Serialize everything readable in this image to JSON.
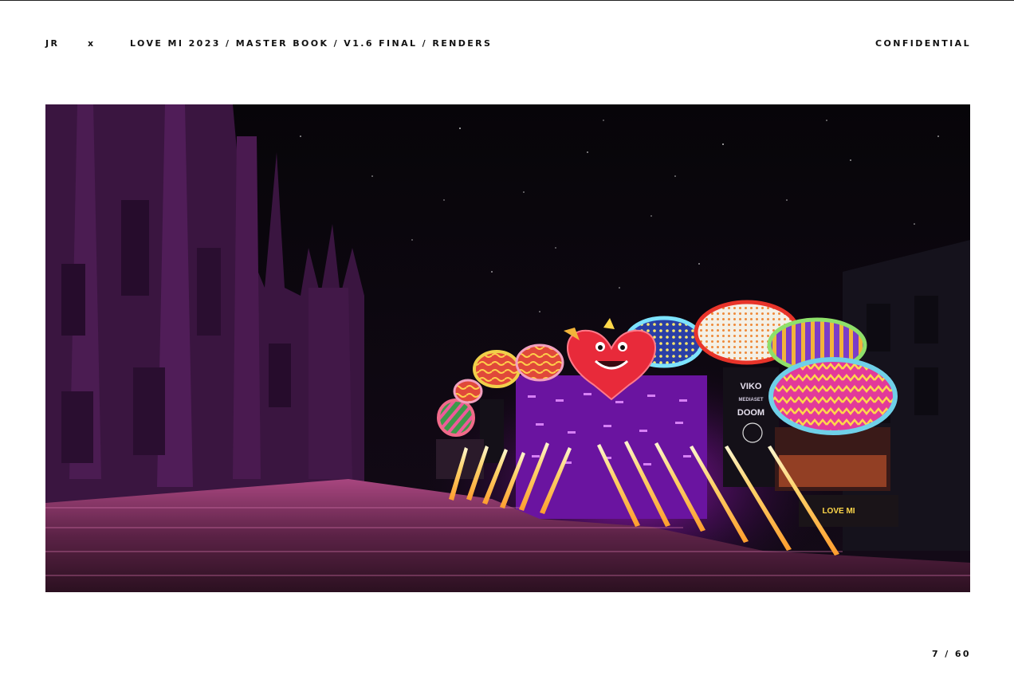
{
  "header": {
    "brand": "JR",
    "separator": "x",
    "path": "LOVE MI 2023 /  MASTER BOOK / V1.6 FINAL / RENDERS",
    "confidential": "CONFIDENTIAL"
  },
  "render": {
    "stage_logos": [
      "VIKO",
      "MEDIASET",
      "DOOM"
    ],
    "screen_banner": "LOVE MI"
  },
  "footer": {
    "page_indicator": "7 / 60"
  }
}
